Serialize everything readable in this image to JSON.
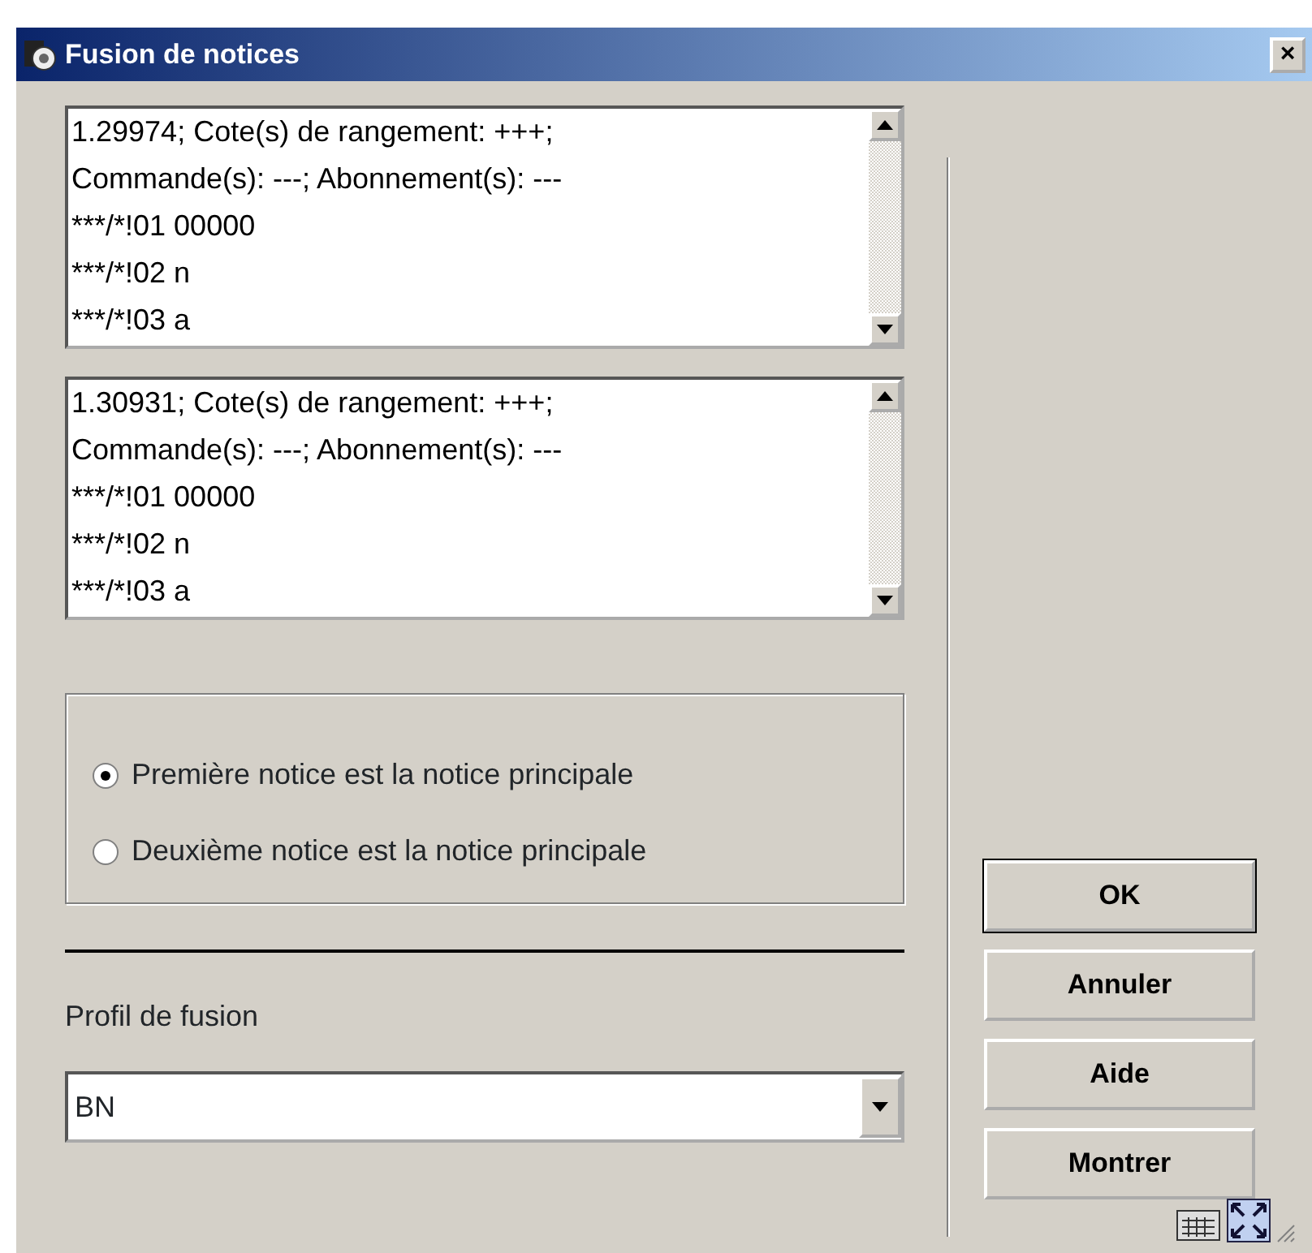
{
  "window": {
    "title": "Fusion de notices",
    "close": "×"
  },
  "records": [
    {
      "lines": [
        "1.29974; Cote(s) de rangement: +++;",
        "Commande(s): ---; Abonnement(s): ---",
        "***/*!01 00000",
        "***/*!02 n",
        "***/*!03 a"
      ]
    },
    {
      "lines": [
        "1.30931; Cote(s) de rangement: +++;",
        "Commande(s): ---; Abonnement(s): ---",
        "***/*!01 00000",
        "***/*!02 n",
        "***/*!03 a"
      ]
    }
  ],
  "main_record_options": [
    {
      "label": "Première notice est la notice principale",
      "selected": true
    },
    {
      "label": "Deuxième notice est la notice principale",
      "selected": false
    }
  ],
  "merge_profile": {
    "label": "Profil de fusion",
    "value": "BN"
  },
  "buttons": [
    {
      "label": "OK",
      "default": true
    },
    {
      "label": "Annuler",
      "default": false
    },
    {
      "label": "Aide",
      "default": false
    },
    {
      "label": "Montrer",
      "default": false
    }
  ]
}
